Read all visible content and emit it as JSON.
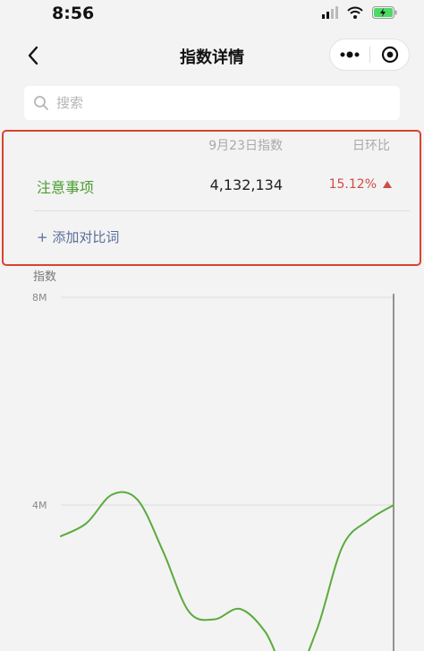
{
  "status_bar": {
    "time": "8:56"
  },
  "nav": {
    "title": "指数详情"
  },
  "search": {
    "placeholder": "搜索"
  },
  "compare": {
    "header_date": "9月23日指数",
    "header_ratio": "日环比",
    "rows": [
      {
        "keyword": "注意事项",
        "value": "4,132,134",
        "change": "15.12%",
        "trend": "up"
      }
    ],
    "add_label": "+ 添加对比词"
  },
  "colors": {
    "accent_red": "#d9432f",
    "keyword_green": "#4a9e2f",
    "line_green": "#5aab3c",
    "change_red": "#d14b44",
    "link_blue": "#5a6e9a"
  },
  "chart_data": {
    "type": "line",
    "ylabel": "指数",
    "y_ticks": [
      "8M",
      "4M"
    ],
    "ylim": [
      0,
      8000000
    ],
    "series": [
      {
        "values": [
          3400000,
          3650000,
          4200000,
          4100000,
          3100000,
          1950000,
          1800000,
          2000000,
          1550000,
          650000,
          1600000,
          3200000,
          3700000,
          4000000
        ]
      }
    ]
  }
}
